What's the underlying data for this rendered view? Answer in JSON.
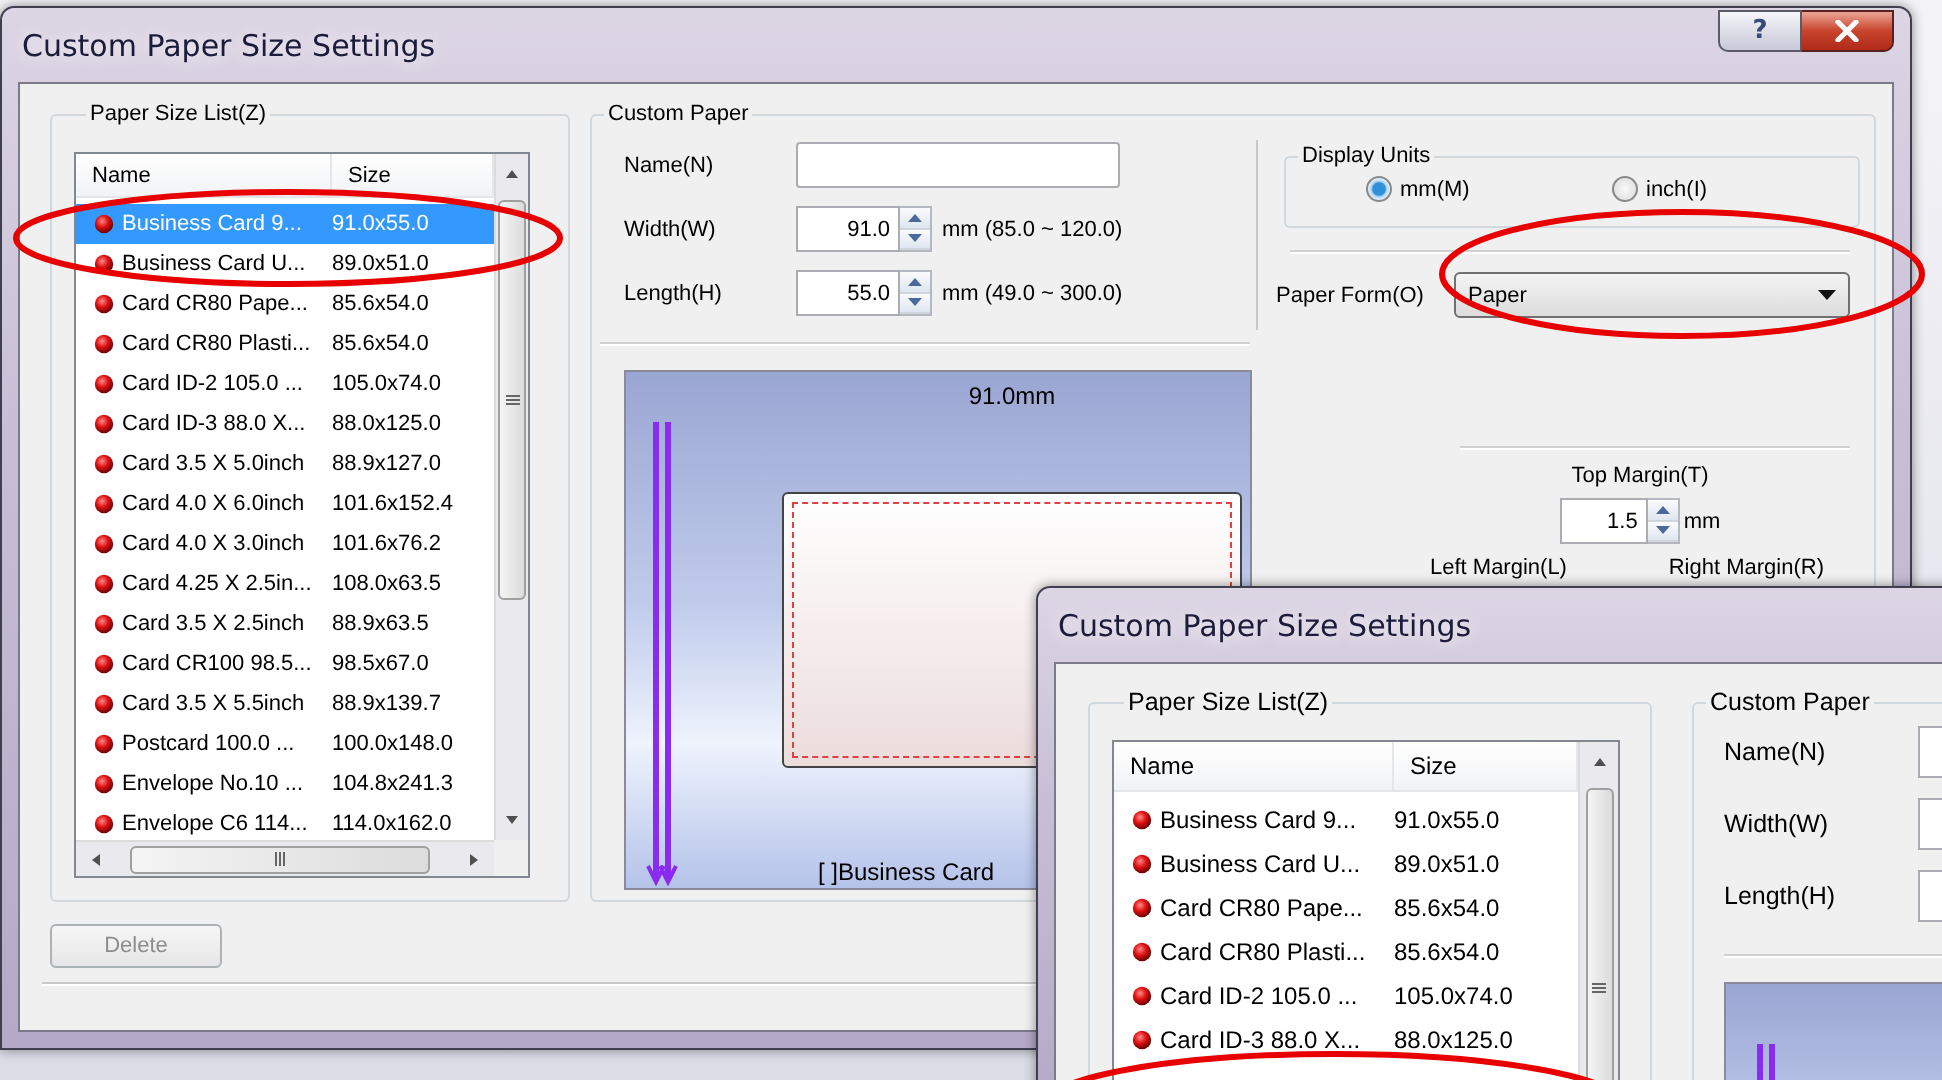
{
  "main_window": {
    "title": "Custom Paper Size Settings",
    "help_button": "?",
    "paper_list": {
      "label": "Paper Size List(Z)",
      "columns": [
        "Name",
        "Size"
      ],
      "rows": [
        {
          "name": "Business Card 9...",
          "size": "91.0x55.0",
          "selected": true
        },
        {
          "name": "Business Card U...",
          "size": "89.0x51.0",
          "selected": false
        },
        {
          "name": "Card CR80 Pape...",
          "size": "85.6x54.0",
          "selected": false
        },
        {
          "name": "Card CR80 Plasti...",
          "size": "85.6x54.0",
          "selected": false
        },
        {
          "name": "Card ID-2 105.0 ...",
          "size": "105.0x74.0",
          "selected": false
        },
        {
          "name": "Card ID-3 88.0 X...",
          "size": "88.0x125.0",
          "selected": false
        },
        {
          "name": "Card 3.5 X 5.0inch",
          "size": "88.9x127.0",
          "selected": false
        },
        {
          "name": "Card 4.0 X 6.0inch",
          "size": "101.6x152.4",
          "selected": false
        },
        {
          "name": "Card 4.0 X 3.0inch",
          "size": "101.6x76.2",
          "selected": false
        },
        {
          "name": "Card 4.25 X 2.5in...",
          "size": "108.0x63.5",
          "selected": false
        },
        {
          "name": "Card 3.5 X 2.5inch",
          "size": "88.9x63.5",
          "selected": false
        },
        {
          "name": "Card CR100 98.5...",
          "size": "98.5x67.0",
          "selected": false
        },
        {
          "name": "Card 3.5 X 5.5inch",
          "size": "88.9x139.7",
          "selected": false
        },
        {
          "name": "Postcard 100.0 ...",
          "size": "100.0x148.0",
          "selected": false
        },
        {
          "name": "Envelope No.10 ...",
          "size": "104.8x241.3",
          "selected": false
        },
        {
          "name": "Envelope C6 114...",
          "size": "114.0x162.0",
          "selected": false
        }
      ]
    },
    "delete_button": {
      "label": "Delete",
      "disabled": true
    },
    "custom_paper": {
      "label": "Custom Paper",
      "fields": [
        {
          "kind": "text",
          "label": "Name(N)"
        },
        {
          "kind": "spin",
          "label": "Width(W)",
          "value": "91.0",
          "range": "mm (85.0 ~ 120.0)"
        },
        {
          "kind": "spin",
          "label": "Length(H)",
          "value": "55.0",
          "range": "mm (49.0 ~ 300.0)"
        }
      ],
      "preview": {
        "width_label": "91.0mm",
        "caption": "[ ]Business Card"
      }
    },
    "display_units": {
      "label": "Display Units",
      "options": [
        {
          "label": "mm(M)",
          "selected": true
        },
        {
          "label": "inch(I)",
          "selected": false
        }
      ]
    },
    "paper_form": {
      "label": "Paper Form(O)",
      "value": "Paper"
    },
    "margins": {
      "top_label": "Top Margin(T)",
      "top_value": "1.5",
      "unit": "mm",
      "left_label": "Left Margin(L)",
      "right_label": "Right Margin(R)"
    }
  },
  "front_window": {
    "title": "Custom Paper Size Settings",
    "paper_list": {
      "label": "Paper Size List(Z)",
      "columns": [
        "Name",
        "Size"
      ],
      "rows": [
        {
          "name": "Business Card 9...",
          "size": "91.0x55.0",
          "selected": false
        },
        {
          "name": "Business Card U...",
          "size": "89.0x51.0",
          "selected": false
        },
        {
          "name": "Card CR80 Pape...",
          "size": "85.6x54.0",
          "selected": false
        },
        {
          "name": "Card CR80 Plasti...",
          "size": "85.6x54.0",
          "selected": false
        },
        {
          "name": "Card ID-2 105.0 ...",
          "size": "105.0x74.0",
          "selected": false
        },
        {
          "name": "Card ID-3 88.0 X...",
          "size": "88.0x125.0",
          "selected": false
        }
      ]
    },
    "custom_paper": {
      "label": "Custom Paper",
      "fields": [
        {
          "label": "Name(N)"
        },
        {
          "label": "Width(W)"
        },
        {
          "label": "Length(H)"
        }
      ]
    }
  }
}
